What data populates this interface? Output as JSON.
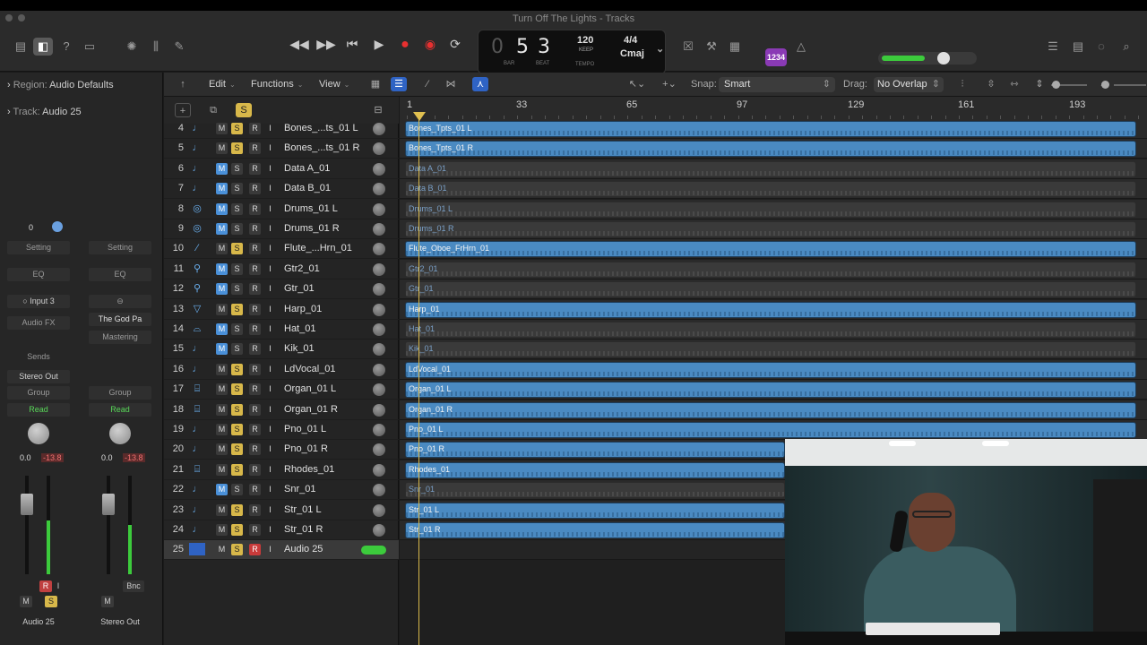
{
  "window": {
    "title": "Turn Off The Lights - Tracks"
  },
  "lcd": {
    "bar": "5",
    "beat": "3",
    "bar_label": "BAR",
    "beat_label": "BEAT",
    "tempo": "120",
    "tempo_sub": "KEEP",
    "tempo_label": "TEMPO",
    "signature": "4/4",
    "key": "Cmaj"
  },
  "badge": "1234",
  "inspector": {
    "region_label": "Region:",
    "region_value": "Audio Defaults",
    "track_label": "Track:",
    "track_value": "Audio 25",
    "strip_left": {
      "value_top": "0",
      "setting": "Setting",
      "eq": "EQ",
      "input": "Input 3",
      "audio_fx": "Audio FX",
      "sends": "Sends",
      "output": "Stereo Out",
      "group": "Group",
      "automation": "Read",
      "vol": "0.0",
      "peak": "-13.8",
      "mute": "M",
      "solo": "S",
      "rec": "R",
      "input_mon": "I",
      "name": "Audio 25"
    },
    "strip_right": {
      "setting": "Setting",
      "eq": "EQ",
      "plugin": "The God Pa",
      "mastering": "Mastering",
      "group": "Group",
      "automation": "Read",
      "vol": "0.0",
      "peak": "-13.8",
      "mute": "M",
      "bounce": "Bnc",
      "name": "Stereo Out"
    }
  },
  "toolbar": {
    "edit": "Edit",
    "functions": "Functions",
    "view": "View",
    "snap_label": "Snap:",
    "snap_value": "Smart",
    "drag_label": "Drag:",
    "drag_value": "No Overlap"
  },
  "track_head": {
    "solo": "S"
  },
  "ruler": {
    "marks": [
      "1",
      "33",
      "65",
      "97",
      "129",
      "161",
      "193"
    ]
  },
  "track_buttons": {
    "m": "M",
    "s": "S",
    "r": "R",
    "i": "I"
  },
  "tracks": [
    {
      "num": "4",
      "name": "Bones_...ts_01 L",
      "region": "Bones_Tpts_01 L",
      "icon": "♩",
      "m_on": false,
      "s_on": true,
      "active": true,
      "len": "full"
    },
    {
      "num": "5",
      "name": "Bones_...ts_01 R",
      "region": "Bones_Tpts_01 R",
      "icon": "♩",
      "m_on": false,
      "s_on": true,
      "active": true,
      "len": "full"
    },
    {
      "num": "6",
      "name": "Data A_01",
      "region": "Data A_01",
      "icon": "♩",
      "m_on": true,
      "s_on": false,
      "active": false,
      "len": "full"
    },
    {
      "num": "7",
      "name": "Data B_01",
      "region": "Data B_01",
      "icon": "♩",
      "m_on": true,
      "s_on": false,
      "active": false,
      "len": "full"
    },
    {
      "num": "8",
      "name": "Drums_01 L",
      "region": "Drums_01 L",
      "icon": "◎",
      "m_on": true,
      "s_on": false,
      "active": false,
      "len": "full"
    },
    {
      "num": "9",
      "name": "Drums_01 R",
      "region": "Drums_01 R",
      "icon": "◎",
      "m_on": true,
      "s_on": false,
      "active": false,
      "len": "full"
    },
    {
      "num": "10",
      "name": "Flute_...Hrn_01",
      "region": "Flute_Oboe_FrHrn_01",
      "icon": "⁄",
      "m_on": false,
      "s_on": true,
      "active": true,
      "len": "full"
    },
    {
      "num": "11",
      "name": "Gtr2_01",
      "region": "Gtr2_01",
      "icon": "⚲",
      "m_on": true,
      "s_on": false,
      "active": false,
      "len": "full"
    },
    {
      "num": "12",
      "name": "Gtr_01",
      "region": "Gtr_01",
      "icon": "⚲",
      "m_on": true,
      "s_on": false,
      "active": false,
      "len": "full"
    },
    {
      "num": "13",
      "name": "Harp_01",
      "region": "Harp_01",
      "icon": "▽",
      "m_on": false,
      "s_on": true,
      "active": true,
      "len": "full"
    },
    {
      "num": "14",
      "name": "Hat_01",
      "region": "Hat_01",
      "icon": "⌓",
      "m_on": true,
      "s_on": false,
      "active": false,
      "len": "full"
    },
    {
      "num": "15",
      "name": "Kik_01",
      "region": "Kik_01",
      "icon": "♩",
      "m_on": true,
      "s_on": false,
      "active": false,
      "len": "full"
    },
    {
      "num": "16",
      "name": "LdVocal_01",
      "region": "LdVocal_01",
      "icon": "♩",
      "m_on": false,
      "s_on": true,
      "active": true,
      "len": "full"
    },
    {
      "num": "17",
      "name": "Organ_01 L",
      "region": "Organ_01 L",
      "icon": "⌸",
      "m_on": false,
      "s_on": true,
      "active": true,
      "len": "full"
    },
    {
      "num": "18",
      "name": "Organ_01 R",
      "region": "Organ_01 R",
      "icon": "⌸",
      "m_on": false,
      "s_on": true,
      "active": true,
      "len": "full"
    },
    {
      "num": "19",
      "name": "Pno_01 L",
      "region": "Pno_01 L",
      "icon": "♩",
      "m_on": false,
      "s_on": true,
      "active": true,
      "len": "full"
    },
    {
      "num": "20",
      "name": "Pno_01 R",
      "region": "Pno_01 R",
      "icon": "♩",
      "m_on": false,
      "s_on": true,
      "active": true,
      "len": "short"
    },
    {
      "num": "21",
      "name": "Rhodes_01",
      "region": "Rhodes_01",
      "icon": "⌸",
      "m_on": false,
      "s_on": true,
      "active": true,
      "len": "short"
    },
    {
      "num": "22",
      "name": "Snr_01",
      "region": "Snr_01",
      "icon": "♩",
      "m_on": true,
      "s_on": false,
      "active": false,
      "len": "short"
    },
    {
      "num": "23",
      "name": "Str_01 L",
      "region": "Str_01 L",
      "icon": "♩",
      "m_on": false,
      "s_on": true,
      "active": true,
      "len": "short"
    },
    {
      "num": "24",
      "name": "Str_01 R",
      "region": "Str_01 R",
      "icon": "♩",
      "m_on": false,
      "s_on": true,
      "active": true,
      "len": "short"
    },
    {
      "num": "25",
      "name": "Audio 25",
      "region": "",
      "icon": "",
      "m_on": false,
      "s_on": true,
      "active": false,
      "len": "none",
      "selected": true,
      "rec": true
    }
  ]
}
